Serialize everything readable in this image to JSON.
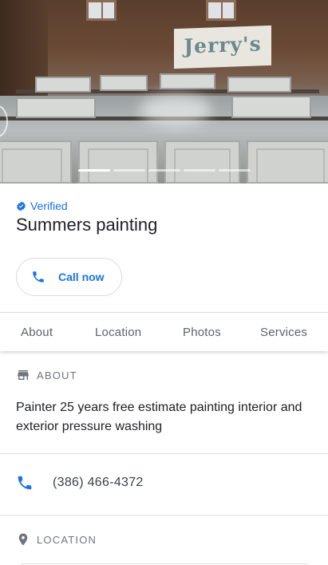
{
  "hero": {
    "sign_text": "Jerry's",
    "photo_count": 5,
    "active_photo_index": 0
  },
  "business": {
    "verified_label": "Verified",
    "name": "Summers painting"
  },
  "actions": {
    "call_label": "Call now"
  },
  "tabs": [
    {
      "label": "About"
    },
    {
      "label": "Location"
    },
    {
      "label": "Photos"
    },
    {
      "label": "Services"
    }
  ],
  "about": {
    "heading": "ABOUT",
    "description": "Painter 25 years free estimate painting interior and exterior pressure washing"
  },
  "contact": {
    "phone": "(386) 466-4372"
  },
  "location": {
    "heading": "LOCATION"
  },
  "colors": {
    "accent_blue": "#1a73e8",
    "text_primary": "#202124",
    "text_secondary": "#70757a",
    "divider": "#e0e0e0"
  },
  "icons": {
    "verified": "verified-badge-icon",
    "call": "phone-icon",
    "about": "storefront-icon",
    "phone": "phone-icon",
    "location": "location-pin-icon"
  }
}
